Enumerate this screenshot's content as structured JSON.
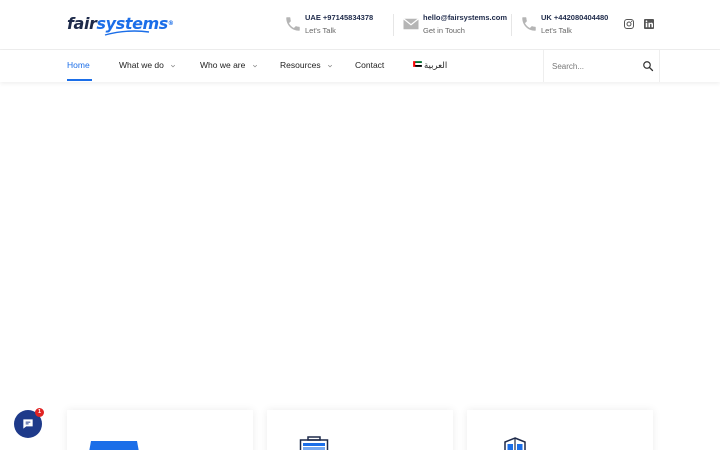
{
  "brand": {
    "name_part1": "fair",
    "name_part2": "systems",
    "mark": "®"
  },
  "contacts": [
    {
      "main": "UAE +97145834378",
      "sub": "Let's Talk",
      "icon": "phone-icon"
    },
    {
      "main": "hello@fairsystems.com",
      "sub": "Get in Touch",
      "icon": "envelope-icon"
    },
    {
      "main": "UK +442080404480",
      "sub": "Let's Talk",
      "icon": "phone-icon"
    }
  ],
  "social": [
    {
      "icon": "instagram-icon"
    },
    {
      "icon": "linkedin-icon"
    }
  ],
  "nav": {
    "items": [
      {
        "label": "Home",
        "active": true
      },
      {
        "label": "What we do",
        "dropdown": true
      },
      {
        "label": "Who we are",
        "dropdown": true
      },
      {
        "label": "Resources",
        "dropdown": true
      },
      {
        "label": "Contact"
      },
      {
        "label": "العربية"
      }
    ]
  },
  "search": {
    "placeholder": "Search..."
  },
  "chat": {
    "badge": "1"
  },
  "colors": {
    "accent": "#1b6ee8",
    "icon_grey": "#b5b5b5",
    "dark": "#1e2a4a",
    "chat": "#1e3a8a",
    "badge": "#e02424"
  }
}
